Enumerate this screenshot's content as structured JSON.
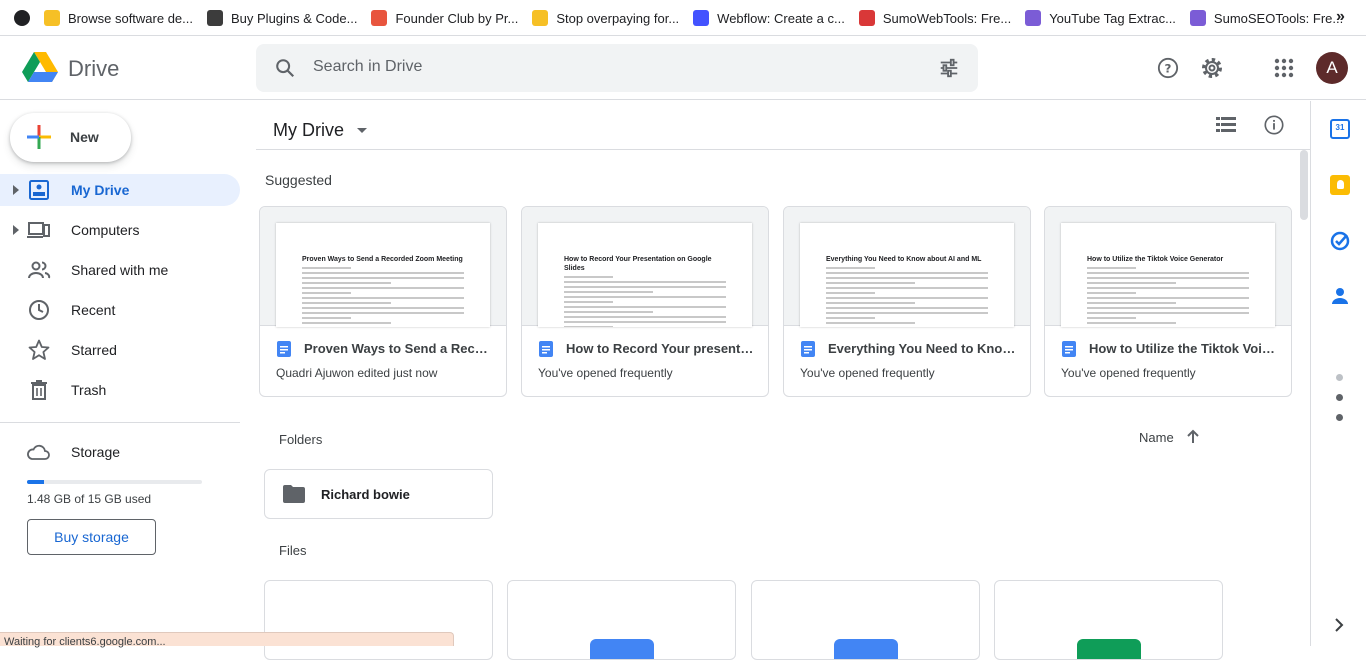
{
  "bookmarks": {
    "items": [
      {
        "label": "Browse software de...",
        "color": "#f6c026"
      },
      {
        "label": "Buy Plugins & Code...",
        "color": "#3c3c3c"
      },
      {
        "label": "Founder Club by Pr...",
        "color": "#e8553e"
      },
      {
        "label": "Stop overpaying for...",
        "color": "#f6c026"
      },
      {
        "label": "Webflow: Create a c...",
        "color": "#4353ff"
      },
      {
        "label": "SumoWebTools: Fre...",
        "color": "#d93838"
      },
      {
        "label": "YouTube Tag Extrac...",
        "color": "#7b5cd6"
      },
      {
        "label": "SumoSEOTools: Fre...",
        "color": "#7b5cd6"
      }
    ],
    "overflow": "»"
  },
  "header": {
    "app_name": "Drive",
    "search_placeholder": "Search in Drive",
    "avatar_initial": "A",
    "avatar_color": "#5d2a2a"
  },
  "sidebar": {
    "new_label": "New",
    "items": [
      {
        "label": "My Drive",
        "icon": "my-drive-icon"
      },
      {
        "label": "Computers",
        "icon": "computer-icon"
      },
      {
        "label": "Shared with me",
        "icon": "shared-icon"
      },
      {
        "label": "Recent",
        "icon": "clock-icon"
      },
      {
        "label": "Starred",
        "icon": "star-icon"
      },
      {
        "label": "Trash",
        "icon": "trash-icon"
      }
    ],
    "storage_label": "Storage",
    "storage_used_text": "1.48 GB of 15 GB used",
    "storage_fraction": 0.099,
    "buy_storage_label": "Buy storage"
  },
  "main": {
    "title": "My Drive",
    "suggested_label": "Suggested",
    "suggested": [
      {
        "title": "Proven Ways to Send a Recor...",
        "subtitle": "Quadri Ajuwon edited just now",
        "doc_heading": "Proven Ways to Send a Recorded Zoom Meeting"
      },
      {
        "title": "How to Record Your presentat...",
        "subtitle": "You've opened frequently",
        "doc_heading": "How to Record Your Presentation on Google Slides"
      },
      {
        "title": "Everything You Need to Know ...",
        "subtitle": "You've opened frequently",
        "doc_heading": "Everything You Need to Know about AI and ML"
      },
      {
        "title": "How to Utilize the Tiktok Voic...",
        "subtitle": "You've opened frequently",
        "doc_heading": "How to Utilize the Tiktok Voice Generator"
      }
    ],
    "folders_label": "Folders",
    "sort_label": "Name",
    "folders": [
      {
        "name": "Richard bowie"
      }
    ],
    "files_label": "Files",
    "file_thumb_colors": [
      "#ffffff",
      "#4285f4",
      "#4285f4",
      "#0f9d58"
    ]
  },
  "status_bar": {
    "text": "Waiting for clients6.google.com..."
  },
  "side_panel": {
    "apps": [
      {
        "name": "calendar-icon",
        "color": "#1a73e8",
        "label": "31"
      },
      {
        "name": "keep-icon",
        "color": "#fbbc04"
      },
      {
        "name": "tasks-icon",
        "color": "#1a73e8"
      },
      {
        "name": "contacts-icon",
        "color": "#1a73e8"
      }
    ]
  }
}
